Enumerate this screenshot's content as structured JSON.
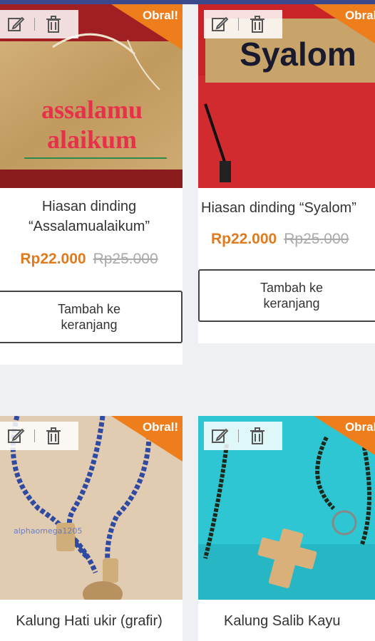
{
  "colors": {
    "accent": "#ee7d1c",
    "price": "#e07a1c",
    "topbar": "#3b4a8c"
  },
  "products": [
    {
      "badge": "Obral!",
      "title_line1": "Hiasan dinding",
      "title_line2": "“Assalamualaikum”",
      "price": "Rp22.000",
      "old_price": "Rp25.000",
      "button_line1": "Tambah ke",
      "button_line2": "keranjang",
      "sign_line1": "assalamu",
      "sign_line2": "alaikum"
    },
    {
      "badge": "Obral!",
      "title": "Hiasan dinding “Syalom”",
      "price": "Rp22.000",
      "old_price": "Rp25.000",
      "button_line1": "Tambah ke",
      "button_line2": "keranjang",
      "sign": "Syalom"
    },
    {
      "badge": "Obral!",
      "title": "Kalung Hati ukir (grafir)",
      "watermark": "alphaomega1205"
    },
    {
      "badge": "Obral!",
      "title": "Kalung Salib Kayu"
    }
  ]
}
